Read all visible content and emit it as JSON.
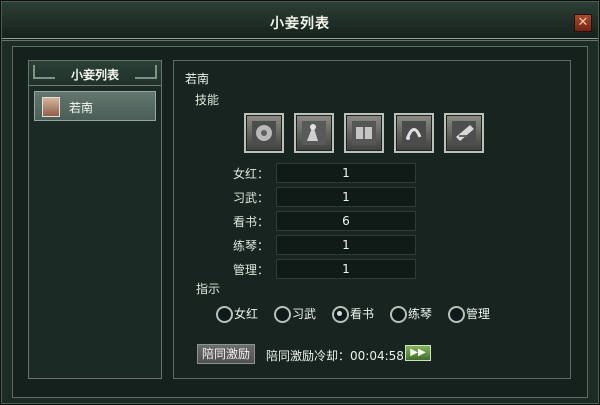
{
  "window": {
    "title": "小妾列表",
    "close_icon": "close-icon"
  },
  "sidebar": {
    "title": "小妾列表",
    "items": [
      {
        "label": "若南",
        "icon": "avatar"
      }
    ]
  },
  "detail": {
    "name": "若南",
    "skills_label": "技能",
    "skill_icons": [
      "needlework-icon",
      "martial-icon",
      "reading-icon",
      "music-icon",
      "management-icon"
    ],
    "stats": [
      {
        "label": "女红：",
        "value": "1"
      },
      {
        "label": "习武：",
        "value": "1"
      },
      {
        "label": "看书：",
        "value": "6"
      },
      {
        "label": "练琴：",
        "value": "1"
      },
      {
        "label": "管理：",
        "value": "1"
      }
    ],
    "instruction_label": "指示",
    "instruction_options": [
      "女红",
      "习武",
      "看书",
      "练琴",
      "管理"
    ],
    "selected_instruction": "看书",
    "accompany_button": "陪同激励",
    "cooldown_text": "陪同激励冷却：00:04:58",
    "arrow_button": "▶▶"
  },
  "colors": {
    "frame": "#5c6e63",
    "selected": "#4a5d56",
    "title": "#f1f3ea"
  }
}
